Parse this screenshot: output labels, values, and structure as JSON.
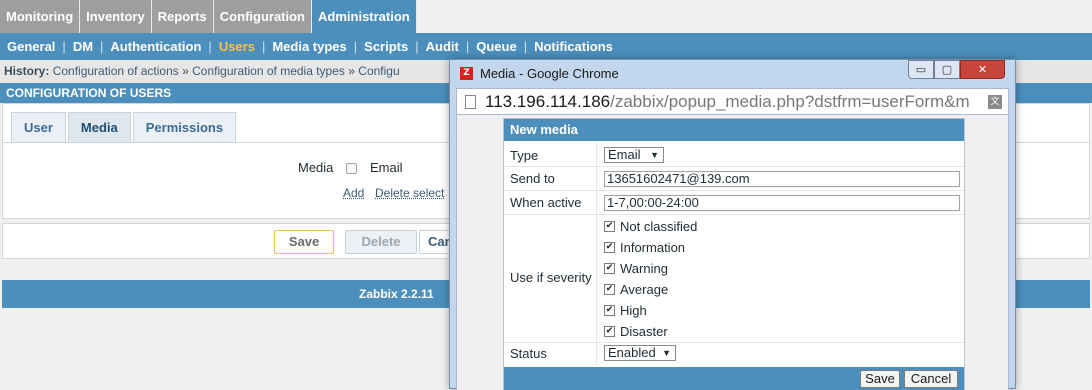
{
  "topnav": [
    "Monitoring",
    "Inventory",
    "Reports",
    "Configuration",
    "Administration"
  ],
  "subnav": [
    "General",
    "DM",
    "Authentication",
    "Users",
    "Media types",
    "Scripts",
    "Audit",
    "Queue",
    "Notifications"
  ],
  "history": {
    "label": "History:",
    "items": [
      "Configuration of actions",
      "Configuration of media types",
      "Configu"
    ],
    "separator": "»"
  },
  "page_title": "CONFIGURATION OF USERS",
  "user_tabs": [
    "User",
    "Media",
    "Permissions"
  ],
  "media_section": {
    "label": "Media",
    "email_label": "Email",
    "add_link": "Add",
    "delete_link": "Delete select"
  },
  "buttons": {
    "save": "Save",
    "delete": "Delete",
    "cancel": "Can"
  },
  "footer": "Zabbix 2.2.11",
  "popup": {
    "title": "Media - Google Chrome",
    "url_host": "113.196.114.186",
    "url_path": "/zabbix/popup_media.php?dstfrm=userForm&m",
    "win_min": "▭",
    "win_max": "▢",
    "win_close": "✕",
    "form": {
      "heading": "New media",
      "type_label": "Type",
      "type_value": "Email",
      "sendto_label": "Send to",
      "sendto_value": "13651602471@139.com",
      "active_label": "When active",
      "active_value": "1-7,00:00-24:00",
      "severity_label": "Use if severity",
      "severities": [
        "Not classified",
        "Information",
        "Warning",
        "Average",
        "High",
        "Disaster"
      ],
      "status_label": "Status",
      "status_value": "Enabled",
      "save": "Save",
      "cancel": "Cancel"
    }
  },
  "colors": {
    "accent_blue": "#4c8fbd",
    "active_subnav": "#f7c242",
    "tab_grey": "#9e9e9e"
  },
  "icons": [
    "dropdown-arrow-icon",
    "checkbox-checked-icon",
    "page-icon",
    "translate-icon",
    "zabbix-app-icon"
  ]
}
